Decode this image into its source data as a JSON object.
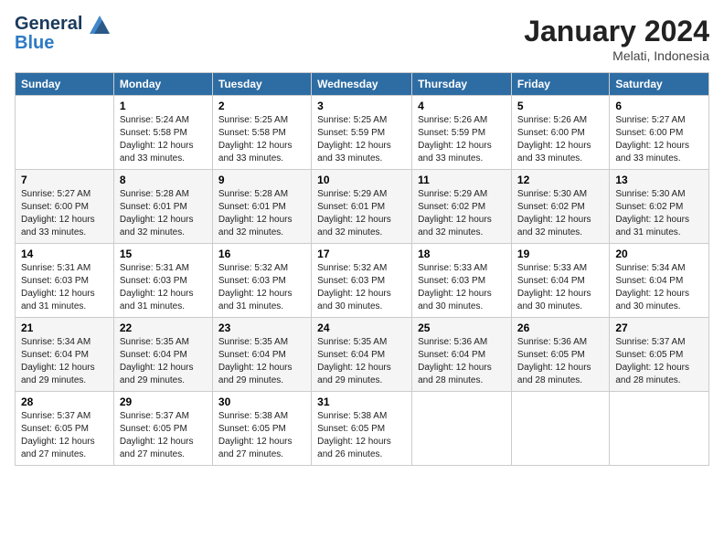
{
  "header": {
    "logo_line1": "General",
    "logo_line2": "Blue",
    "month_title": "January 2024",
    "location": "Melati, Indonesia"
  },
  "days_of_week": [
    "Sunday",
    "Monday",
    "Tuesday",
    "Wednesday",
    "Thursday",
    "Friday",
    "Saturday"
  ],
  "weeks": [
    [
      {
        "day": "",
        "content": ""
      },
      {
        "day": "1",
        "content": "Sunrise: 5:24 AM\nSunset: 5:58 PM\nDaylight: 12 hours\nand 33 minutes."
      },
      {
        "day": "2",
        "content": "Sunrise: 5:25 AM\nSunset: 5:58 PM\nDaylight: 12 hours\nand 33 minutes."
      },
      {
        "day": "3",
        "content": "Sunrise: 5:25 AM\nSunset: 5:59 PM\nDaylight: 12 hours\nand 33 minutes."
      },
      {
        "day": "4",
        "content": "Sunrise: 5:26 AM\nSunset: 5:59 PM\nDaylight: 12 hours\nand 33 minutes."
      },
      {
        "day": "5",
        "content": "Sunrise: 5:26 AM\nSunset: 6:00 PM\nDaylight: 12 hours\nand 33 minutes."
      },
      {
        "day": "6",
        "content": "Sunrise: 5:27 AM\nSunset: 6:00 PM\nDaylight: 12 hours\nand 33 minutes."
      }
    ],
    [
      {
        "day": "7",
        "content": "Sunrise: 5:27 AM\nSunset: 6:00 PM\nDaylight: 12 hours\nand 33 minutes."
      },
      {
        "day": "8",
        "content": "Sunrise: 5:28 AM\nSunset: 6:01 PM\nDaylight: 12 hours\nand 32 minutes."
      },
      {
        "day": "9",
        "content": "Sunrise: 5:28 AM\nSunset: 6:01 PM\nDaylight: 12 hours\nand 32 minutes."
      },
      {
        "day": "10",
        "content": "Sunrise: 5:29 AM\nSunset: 6:01 PM\nDaylight: 12 hours\nand 32 minutes."
      },
      {
        "day": "11",
        "content": "Sunrise: 5:29 AM\nSunset: 6:02 PM\nDaylight: 12 hours\nand 32 minutes."
      },
      {
        "day": "12",
        "content": "Sunrise: 5:30 AM\nSunset: 6:02 PM\nDaylight: 12 hours\nand 32 minutes."
      },
      {
        "day": "13",
        "content": "Sunrise: 5:30 AM\nSunset: 6:02 PM\nDaylight: 12 hours\nand 31 minutes."
      }
    ],
    [
      {
        "day": "14",
        "content": "Sunrise: 5:31 AM\nSunset: 6:03 PM\nDaylight: 12 hours\nand 31 minutes."
      },
      {
        "day": "15",
        "content": "Sunrise: 5:31 AM\nSunset: 6:03 PM\nDaylight: 12 hours\nand 31 minutes."
      },
      {
        "day": "16",
        "content": "Sunrise: 5:32 AM\nSunset: 6:03 PM\nDaylight: 12 hours\nand 31 minutes."
      },
      {
        "day": "17",
        "content": "Sunrise: 5:32 AM\nSunset: 6:03 PM\nDaylight: 12 hours\nand 30 minutes."
      },
      {
        "day": "18",
        "content": "Sunrise: 5:33 AM\nSunset: 6:03 PM\nDaylight: 12 hours\nand 30 minutes."
      },
      {
        "day": "19",
        "content": "Sunrise: 5:33 AM\nSunset: 6:04 PM\nDaylight: 12 hours\nand 30 minutes."
      },
      {
        "day": "20",
        "content": "Sunrise: 5:34 AM\nSunset: 6:04 PM\nDaylight: 12 hours\nand 30 minutes."
      }
    ],
    [
      {
        "day": "21",
        "content": "Sunrise: 5:34 AM\nSunset: 6:04 PM\nDaylight: 12 hours\nand 29 minutes."
      },
      {
        "day": "22",
        "content": "Sunrise: 5:35 AM\nSunset: 6:04 PM\nDaylight: 12 hours\nand 29 minutes."
      },
      {
        "day": "23",
        "content": "Sunrise: 5:35 AM\nSunset: 6:04 PM\nDaylight: 12 hours\nand 29 minutes."
      },
      {
        "day": "24",
        "content": "Sunrise: 5:35 AM\nSunset: 6:04 PM\nDaylight: 12 hours\nand 29 minutes."
      },
      {
        "day": "25",
        "content": "Sunrise: 5:36 AM\nSunset: 6:04 PM\nDaylight: 12 hours\nand 28 minutes."
      },
      {
        "day": "26",
        "content": "Sunrise: 5:36 AM\nSunset: 6:05 PM\nDaylight: 12 hours\nand 28 minutes."
      },
      {
        "day": "27",
        "content": "Sunrise: 5:37 AM\nSunset: 6:05 PM\nDaylight: 12 hours\nand 28 minutes."
      }
    ],
    [
      {
        "day": "28",
        "content": "Sunrise: 5:37 AM\nSunset: 6:05 PM\nDaylight: 12 hours\nand 27 minutes."
      },
      {
        "day": "29",
        "content": "Sunrise: 5:37 AM\nSunset: 6:05 PM\nDaylight: 12 hours\nand 27 minutes."
      },
      {
        "day": "30",
        "content": "Sunrise: 5:38 AM\nSunset: 6:05 PM\nDaylight: 12 hours\nand 27 minutes."
      },
      {
        "day": "31",
        "content": "Sunrise: 5:38 AM\nSunset: 6:05 PM\nDaylight: 12 hours\nand 26 minutes."
      },
      {
        "day": "",
        "content": ""
      },
      {
        "day": "",
        "content": ""
      },
      {
        "day": "",
        "content": ""
      }
    ]
  ]
}
